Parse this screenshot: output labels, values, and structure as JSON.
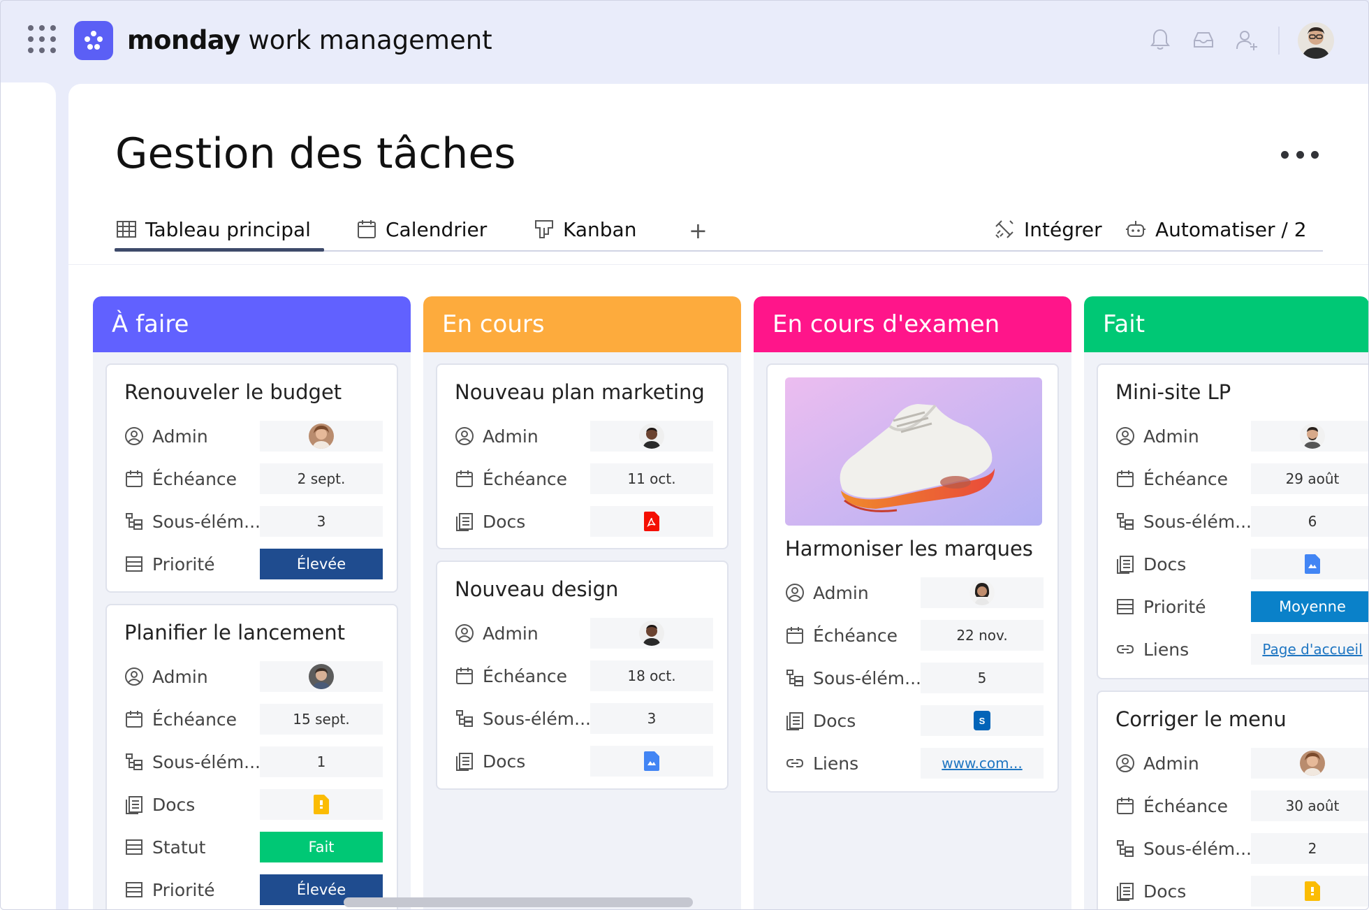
{
  "app": {
    "brand_bold": "monday",
    "brand_rest": " work management"
  },
  "page": {
    "title": "Gestion des tâches"
  },
  "tabs": [
    {
      "label": "Tableau principal",
      "icon": "table-icon"
    },
    {
      "label": "Calendrier",
      "icon": "calendar-icon"
    },
    {
      "label": "Kanban",
      "icon": "kanban-icon"
    }
  ],
  "tab_add": "+",
  "actions": {
    "integrate": "Intégrer",
    "automate": "Automatiser / 2"
  },
  "field_labels": {
    "admin": "Admin",
    "due": "Échéance",
    "subitems": "Sous-élém...",
    "docs": "Docs",
    "priority": "Priorité",
    "status": "Statut",
    "links": "Liens"
  },
  "colors": {
    "todo": "#6161ff",
    "in_progress": "#fdab3d",
    "review": "#ff158a",
    "done": "#00c875",
    "priority_high": "#1f4c8f",
    "priority_medium": "#0a81c9",
    "status_done": "#00c875",
    "link": "#1f76c2"
  },
  "columns": [
    {
      "title": "À faire",
      "cards": [
        {
          "title": "Renouveler le budget",
          "due": "2 sept.",
          "subitems": "3",
          "priority": "Élevée"
        },
        {
          "title": "Planifier  le lancement",
          "due": "15 sept.",
          "subitems": "1",
          "status": "Fait",
          "priority": "Élevée"
        }
      ]
    },
    {
      "title": "En cours",
      "cards": [
        {
          "title": "Nouveau plan marketing",
          "due": "11 oct."
        },
        {
          "title": "Nouveau design",
          "due": "18 oct.",
          "subitems": "3"
        }
      ]
    },
    {
      "title": "En cours d'examen",
      "cards": [
        {
          "title": "Harmoniser les marques",
          "due": "22 nov.",
          "subitems": "5",
          "link": "www.com..."
        }
      ]
    },
    {
      "title": "Fait",
      "cards": [
        {
          "title": "Mini-site LP",
          "due": "29 août",
          "subitems": "6",
          "priority": "Moyenne",
          "link": "Page d'accueil"
        },
        {
          "title": "Corriger le menu",
          "due": "30 août",
          "subitems": "2"
        }
      ]
    }
  ]
}
